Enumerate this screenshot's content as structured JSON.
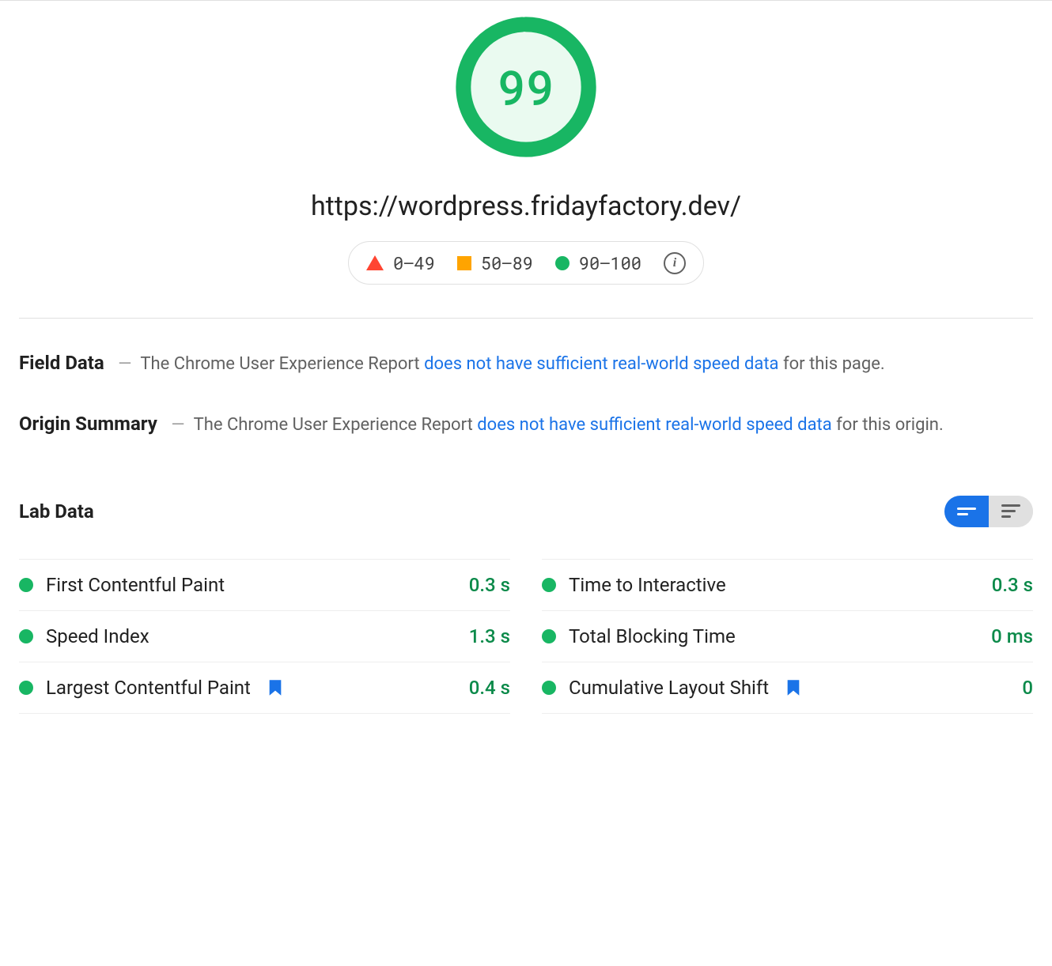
{
  "score": 99,
  "url": "https://wordpress.fridayfactory.dev/",
  "legend": {
    "poor": "0–49",
    "average": "50–89",
    "good": "90–100"
  },
  "fieldData": {
    "title": "Field Data",
    "prefix": "The Chrome User Experience Report ",
    "link": "does not have sufficient real-world speed data",
    "suffix": " for this page."
  },
  "originSummary": {
    "title": "Origin Summary",
    "prefix": "The Chrome User Experience Report ",
    "link": "does not have sufficient real-world speed data",
    "suffix": " for this origin."
  },
  "labData": {
    "title": "Lab Data",
    "metrics_left": [
      {
        "label": "First Contentful Paint",
        "value": "0.3 s",
        "bookmark": false
      },
      {
        "label": "Speed Index",
        "value": "1.3 s",
        "bookmark": false
      },
      {
        "label": "Largest Contentful Paint",
        "value": "0.4 s",
        "bookmark": true
      }
    ],
    "metrics_right": [
      {
        "label": "Time to Interactive",
        "value": "0.3 s",
        "bookmark": false
      },
      {
        "label": "Total Blocking Time",
        "value": "0 ms",
        "bookmark": false
      },
      {
        "label": "Cumulative Layout Shift",
        "value": "0",
        "bookmark": true
      }
    ]
  }
}
